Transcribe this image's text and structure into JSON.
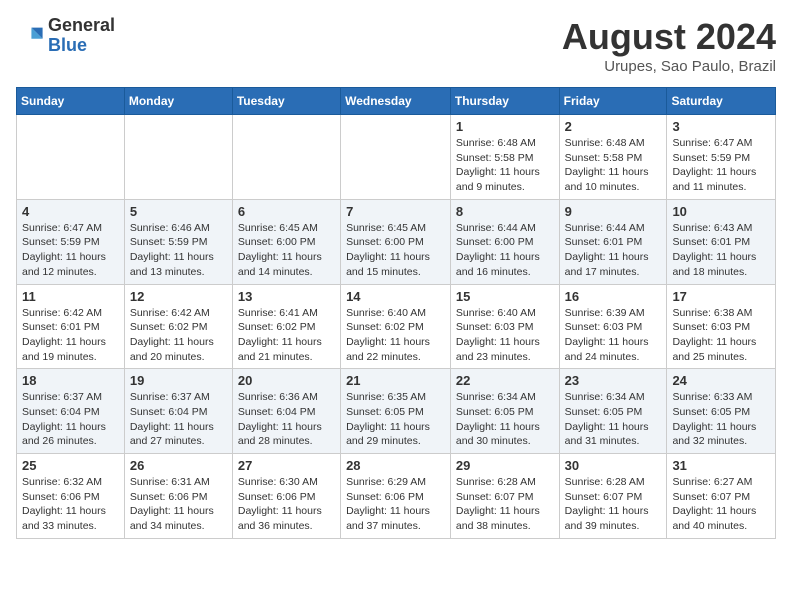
{
  "header": {
    "logo_line1": "General",
    "logo_line2": "Blue",
    "title": "August 2024",
    "subtitle": "Urupes, Sao Paulo, Brazil"
  },
  "calendar": {
    "days_of_week": [
      "Sunday",
      "Monday",
      "Tuesday",
      "Wednesday",
      "Thursday",
      "Friday",
      "Saturday"
    ],
    "weeks": [
      [
        {
          "day": "",
          "info": ""
        },
        {
          "day": "",
          "info": ""
        },
        {
          "day": "",
          "info": ""
        },
        {
          "day": "",
          "info": ""
        },
        {
          "day": "1",
          "info": "Sunrise: 6:48 AM\nSunset: 5:58 PM\nDaylight: 11 hours\nand 9 minutes."
        },
        {
          "day": "2",
          "info": "Sunrise: 6:48 AM\nSunset: 5:58 PM\nDaylight: 11 hours\nand 10 minutes."
        },
        {
          "day": "3",
          "info": "Sunrise: 6:47 AM\nSunset: 5:59 PM\nDaylight: 11 hours\nand 11 minutes."
        }
      ],
      [
        {
          "day": "4",
          "info": "Sunrise: 6:47 AM\nSunset: 5:59 PM\nDaylight: 11 hours\nand 12 minutes."
        },
        {
          "day": "5",
          "info": "Sunrise: 6:46 AM\nSunset: 5:59 PM\nDaylight: 11 hours\nand 13 minutes."
        },
        {
          "day": "6",
          "info": "Sunrise: 6:45 AM\nSunset: 6:00 PM\nDaylight: 11 hours\nand 14 minutes."
        },
        {
          "day": "7",
          "info": "Sunrise: 6:45 AM\nSunset: 6:00 PM\nDaylight: 11 hours\nand 15 minutes."
        },
        {
          "day": "8",
          "info": "Sunrise: 6:44 AM\nSunset: 6:00 PM\nDaylight: 11 hours\nand 16 minutes."
        },
        {
          "day": "9",
          "info": "Sunrise: 6:44 AM\nSunset: 6:01 PM\nDaylight: 11 hours\nand 17 minutes."
        },
        {
          "day": "10",
          "info": "Sunrise: 6:43 AM\nSunset: 6:01 PM\nDaylight: 11 hours\nand 18 minutes."
        }
      ],
      [
        {
          "day": "11",
          "info": "Sunrise: 6:42 AM\nSunset: 6:01 PM\nDaylight: 11 hours\nand 19 minutes."
        },
        {
          "day": "12",
          "info": "Sunrise: 6:42 AM\nSunset: 6:02 PM\nDaylight: 11 hours\nand 20 minutes."
        },
        {
          "day": "13",
          "info": "Sunrise: 6:41 AM\nSunset: 6:02 PM\nDaylight: 11 hours\nand 21 minutes."
        },
        {
          "day": "14",
          "info": "Sunrise: 6:40 AM\nSunset: 6:02 PM\nDaylight: 11 hours\nand 22 minutes."
        },
        {
          "day": "15",
          "info": "Sunrise: 6:40 AM\nSunset: 6:03 PM\nDaylight: 11 hours\nand 23 minutes."
        },
        {
          "day": "16",
          "info": "Sunrise: 6:39 AM\nSunset: 6:03 PM\nDaylight: 11 hours\nand 24 minutes."
        },
        {
          "day": "17",
          "info": "Sunrise: 6:38 AM\nSunset: 6:03 PM\nDaylight: 11 hours\nand 25 minutes."
        }
      ],
      [
        {
          "day": "18",
          "info": "Sunrise: 6:37 AM\nSunset: 6:04 PM\nDaylight: 11 hours\nand 26 minutes."
        },
        {
          "day": "19",
          "info": "Sunrise: 6:37 AM\nSunset: 6:04 PM\nDaylight: 11 hours\nand 27 minutes."
        },
        {
          "day": "20",
          "info": "Sunrise: 6:36 AM\nSunset: 6:04 PM\nDaylight: 11 hours\nand 28 minutes."
        },
        {
          "day": "21",
          "info": "Sunrise: 6:35 AM\nSunset: 6:05 PM\nDaylight: 11 hours\nand 29 minutes."
        },
        {
          "day": "22",
          "info": "Sunrise: 6:34 AM\nSunset: 6:05 PM\nDaylight: 11 hours\nand 30 minutes."
        },
        {
          "day": "23",
          "info": "Sunrise: 6:34 AM\nSunset: 6:05 PM\nDaylight: 11 hours\nand 31 minutes."
        },
        {
          "day": "24",
          "info": "Sunrise: 6:33 AM\nSunset: 6:05 PM\nDaylight: 11 hours\nand 32 minutes."
        }
      ],
      [
        {
          "day": "25",
          "info": "Sunrise: 6:32 AM\nSunset: 6:06 PM\nDaylight: 11 hours\nand 33 minutes."
        },
        {
          "day": "26",
          "info": "Sunrise: 6:31 AM\nSunset: 6:06 PM\nDaylight: 11 hours\nand 34 minutes."
        },
        {
          "day": "27",
          "info": "Sunrise: 6:30 AM\nSunset: 6:06 PM\nDaylight: 11 hours\nand 36 minutes."
        },
        {
          "day": "28",
          "info": "Sunrise: 6:29 AM\nSunset: 6:06 PM\nDaylight: 11 hours\nand 37 minutes."
        },
        {
          "day": "29",
          "info": "Sunrise: 6:28 AM\nSunset: 6:07 PM\nDaylight: 11 hours\nand 38 minutes."
        },
        {
          "day": "30",
          "info": "Sunrise: 6:28 AM\nSunset: 6:07 PM\nDaylight: 11 hours\nand 39 minutes."
        },
        {
          "day": "31",
          "info": "Sunrise: 6:27 AM\nSunset: 6:07 PM\nDaylight: 11 hours\nand 40 minutes."
        }
      ]
    ]
  }
}
